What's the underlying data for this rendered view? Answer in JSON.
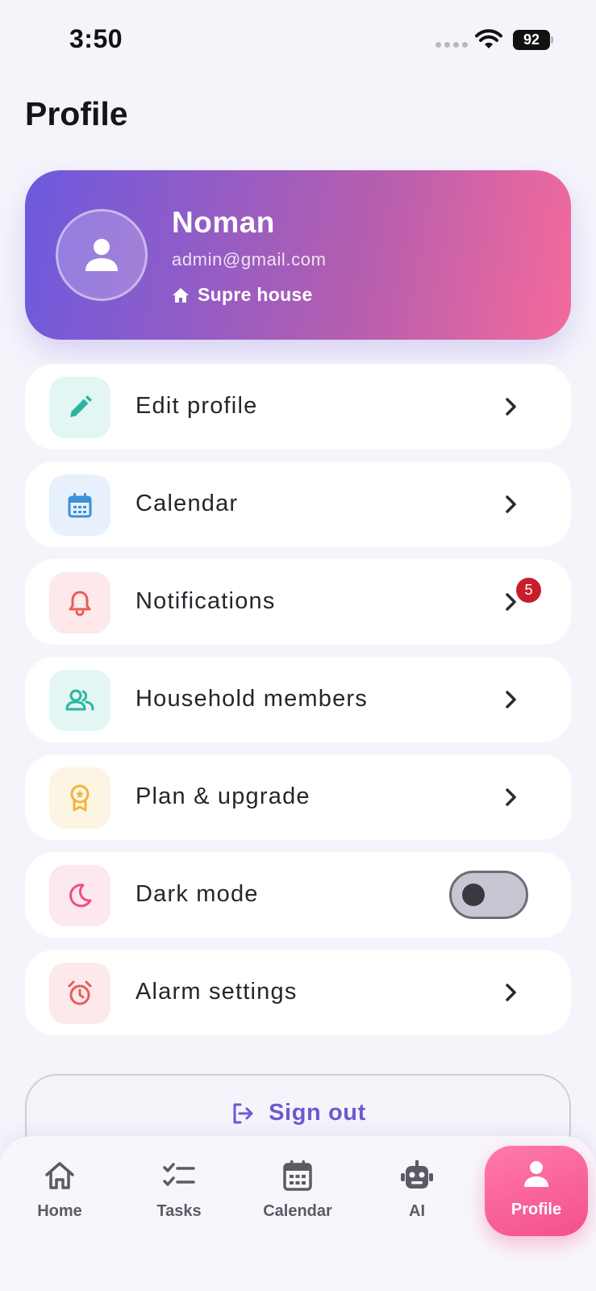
{
  "status_bar": {
    "time": "3:50",
    "battery": "92"
  },
  "header": {
    "title": "Profile"
  },
  "profile": {
    "name": "Noman",
    "email": "admin@gmail.com",
    "house": "Supre house"
  },
  "menu": [
    {
      "label": "Edit profile",
      "icon": "pencil-icon",
      "icon_color": "#2bb5a0",
      "icon_bg": "#e4f6f3"
    },
    {
      "label": "Calendar",
      "icon": "calendar-icon",
      "icon_color": "#3f8fd6",
      "icon_bg": "#e6f1fb"
    },
    {
      "label": "Notifications",
      "icon": "bell-icon",
      "icon_color": "#ea5b5b",
      "icon_bg": "#fde9e9",
      "badge": "5"
    },
    {
      "label": "Household members",
      "icon": "people-icon",
      "icon_color": "#2bb5a0",
      "icon_bg": "#e4f6f3"
    },
    {
      "label": "Plan & upgrade",
      "icon": "award-icon",
      "icon_color": "#f2b33d",
      "icon_bg": "#fdf5e4"
    },
    {
      "label": "Dark mode",
      "icon": "moon-icon",
      "icon_color": "#ec4f8a",
      "icon_bg": "#fde8ef",
      "toggle_on": false
    },
    {
      "label": "Alarm settings",
      "icon": "alarm-clock-icon",
      "icon_color": "#ea5b5b",
      "icon_bg": "#fde9e9"
    }
  ],
  "sign_out": {
    "label": "Sign out"
  },
  "bottom_nav": {
    "items": [
      {
        "label": "Home",
        "icon": "home-icon"
      },
      {
        "label": "Tasks",
        "icon": "tasks-icon"
      },
      {
        "label": "Calendar",
        "icon": "calendar-icon"
      },
      {
        "label": "AI",
        "icon": "robot-icon"
      },
      {
        "label": "Profile",
        "icon": "person-icon",
        "active": true
      }
    ]
  },
  "colors": {
    "accent": "#6a5bd0",
    "active_tab": "#f3508d",
    "card_gradient_start": "#6d5ade",
    "card_gradient_end": "#f46a9b"
  }
}
